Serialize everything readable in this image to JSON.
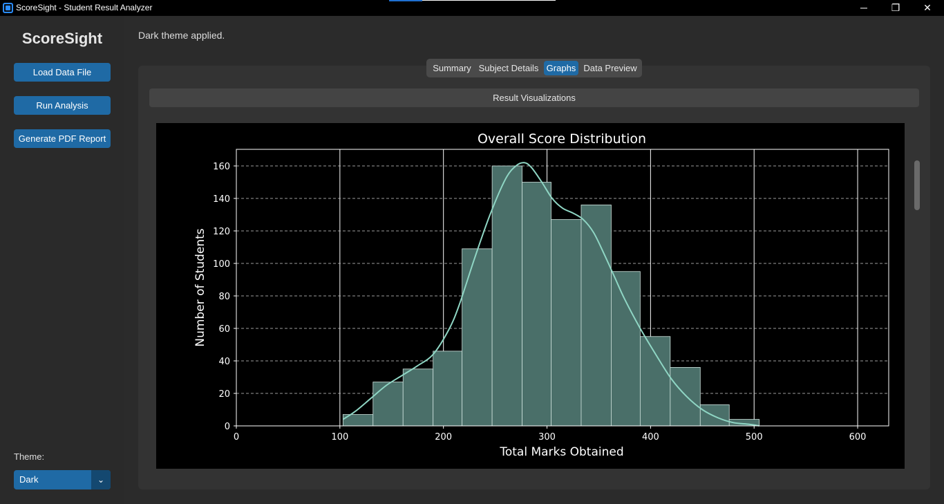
{
  "window": {
    "title": "ScoreSight - Student Result Analyzer",
    "controls": {
      "minimize": "─",
      "maximize": "❐",
      "close": "✕"
    }
  },
  "sidebar": {
    "brand": "ScoreSight",
    "buttons": {
      "load": "Load Data File",
      "run": "Run Analysis",
      "pdf": "Generate PDF Report"
    },
    "theme_label": "Theme:",
    "theme_value": "Dark",
    "theme_arrow": "⌄"
  },
  "status_message": "Dark theme applied.",
  "tabs": {
    "summary": "Summary",
    "subject": "Subject Details",
    "graphs": "Graphs",
    "preview": "Data Preview"
  },
  "section_title": "Result Visualizations",
  "colors": {
    "accent": "#1f6aa5",
    "bar_fill": "#4a6f69",
    "kde_line": "#8fd6c4"
  },
  "chart_data": {
    "type": "bar",
    "title": "Overall Score Distribution",
    "xlabel": "Total Marks Obtained",
    "ylabel": "Number of Students",
    "xlim": [
      0,
      630
    ],
    "ylim": [
      0,
      160
    ],
    "x_ticks": [
      0,
      100,
      200,
      300,
      400,
      500,
      600
    ],
    "y_ticks": [
      0,
      20,
      40,
      60,
      80,
      100,
      120,
      140,
      160
    ],
    "grid": true,
    "bins": [
      {
        "start": 103,
        "end": 132,
        "count": 7
      },
      {
        "start": 132,
        "end": 161,
        "count": 27
      },
      {
        "start": 161,
        "end": 190,
        "count": 35
      },
      {
        "start": 190,
        "end": 218,
        "count": 46
      },
      {
        "start": 218,
        "end": 247,
        "count": 109
      },
      {
        "start": 247,
        "end": 276,
        "count": 160
      },
      {
        "start": 276,
        "end": 304,
        "count": 150
      },
      {
        "start": 304,
        "end": 333,
        "count": 127
      },
      {
        "start": 333,
        "end": 362,
        "count": 136
      },
      {
        "start": 362,
        "end": 390,
        "count": 95
      },
      {
        "start": 390,
        "end": 419,
        "count": 55
      },
      {
        "start": 419,
        "end": 448,
        "count": 36
      },
      {
        "start": 448,
        "end": 476,
        "count": 13
      },
      {
        "start": 476,
        "end": 505,
        "count": 4
      }
    ],
    "kde": {
      "x": [
        103,
        115,
        130,
        145,
        160,
        175,
        190,
        205,
        215,
        230,
        245,
        260,
        270,
        278,
        285,
        295,
        305,
        315,
        325,
        335,
        345,
        355,
        365,
        375,
        390,
        405,
        420,
        435,
        450,
        465,
        480,
        495,
        505
      ],
      "y": [
        4,
        9,
        17,
        25,
        31,
        37,
        44,
        59,
        74,
        103,
        130,
        152,
        160,
        162,
        159,
        150,
        140,
        134,
        131,
        127,
        119,
        106,
        92,
        78,
        60,
        44,
        29,
        18,
        10,
        5,
        2,
        1,
        0
      ]
    }
  }
}
